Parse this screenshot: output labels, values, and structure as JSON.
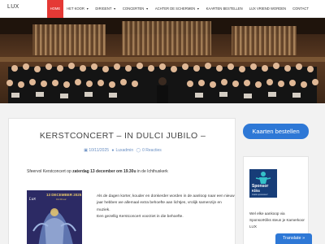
{
  "brand": "LUX",
  "nav": {
    "home": "HOME",
    "koor": "HET KOOR",
    "dirigent": "DIRIGENT",
    "concerten": "CONCERTEN",
    "schermen": "ACHTER DE SCHERMEN",
    "kaarten": "KAARTEN BESTELLEN",
    "vriend": "LUX VRIEND WORDEN",
    "contact": "CONTACT"
  },
  "post": {
    "title": "KERSTCONCERT – IN DULCI JUBILO –",
    "date": "10/11/2025",
    "author": "Luxadmin",
    "reactions": "0 Reacties",
    "lead_prefix": "Sfeervol Kerstconcert op ",
    "lead_bold": "zaterdag 13 december om 19.30u",
    "lead_suffix": " in de Ichthuskerk",
    "poster_date": "13 DECEMBER 2025",
    "poster_sub": "19.30 uur",
    "poster_logo": "Lux",
    "body_line1": "Als de dagen korter, kouder en donkerder worden in de aanloop naar een nieuw jaar hebben we allemaal extra behoefte aan lichtjes, vrolijk samenzijn en muziek.",
    "body_line2": "Een gezellig Kerstconcert voorziet in die behoefte."
  },
  "sidebar": {
    "button": "Kaarten bestellen",
    "sponsor_logo_line1": "Sponsor",
    "sponsor_logo_line2": "Kliks",
    "sponsor_logo_line3": "Gratis sponsoren!",
    "sponsor_text": "Wel elke aankoop via SponsorKliks steun je Kamerkoor LUX"
  },
  "translate": "Translate »",
  "colors": {
    "nav_active": "#e53935",
    "accent_blue": "#2e78d6",
    "meta_blue": "#6a8fc3"
  }
}
